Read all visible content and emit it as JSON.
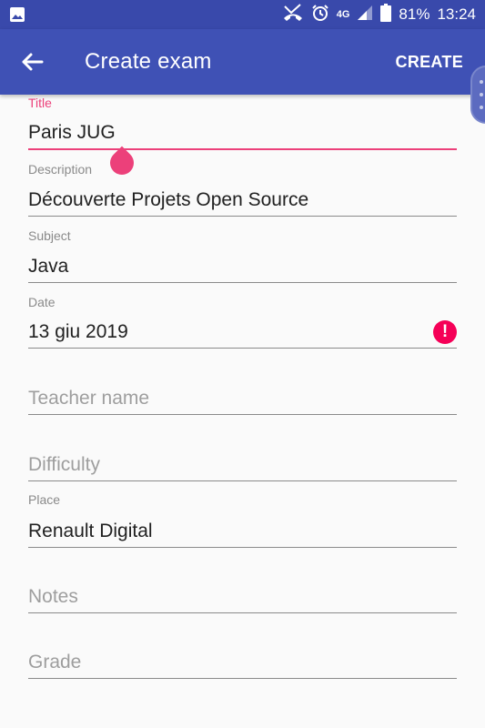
{
  "status_bar": {
    "network": "4G",
    "battery": "81%",
    "time": "13:24",
    "icons": [
      "image-icon",
      "missed-call-icon",
      "alarm-icon",
      "signal-icon",
      "battery-icon"
    ]
  },
  "app_bar": {
    "title": "Create exam",
    "create_label": "CREATE",
    "colors": {
      "primary": "#3f51b5",
      "status": "#3949ab",
      "accent": "#ec407a",
      "error": "#f50057"
    }
  },
  "form": {
    "title": {
      "label": "Title",
      "value": "Paris JUG"
    },
    "description": {
      "label": "Description",
      "value": "Découverte Projets Open Source"
    },
    "subject": {
      "label": "Subject",
      "value": "Java"
    },
    "date": {
      "label": "Date",
      "value": "13 giu 2019",
      "error_icon": "!"
    },
    "teacher": {
      "placeholder": "Teacher name"
    },
    "difficulty": {
      "placeholder": "Difficulty"
    },
    "place": {
      "label": "Place",
      "value": "Renault Digital"
    },
    "notes": {
      "placeholder": "Notes"
    },
    "grade": {
      "placeholder": "Grade"
    }
  }
}
